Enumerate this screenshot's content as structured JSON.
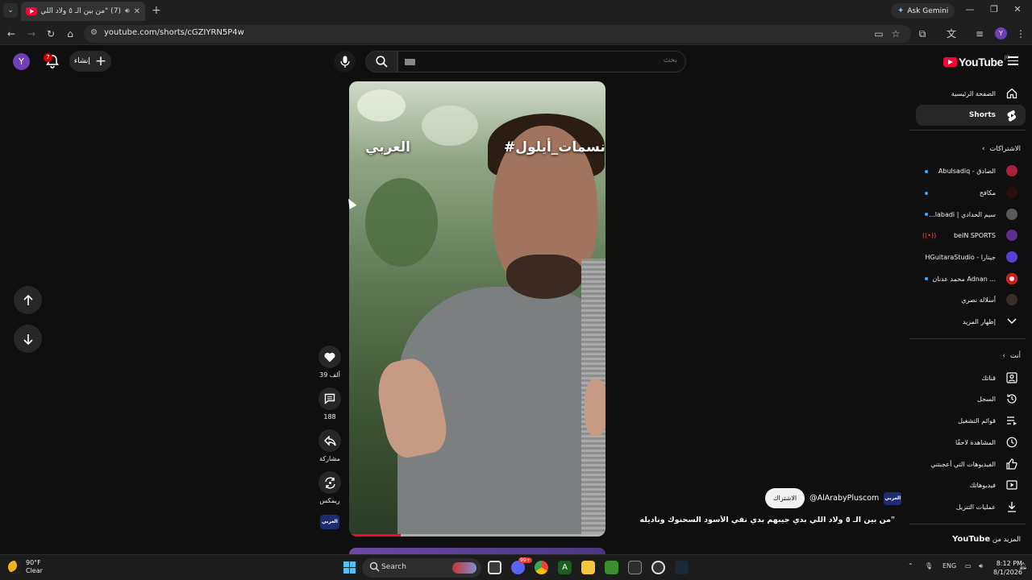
{
  "browser": {
    "tab_title": "(7) \"من بين الـ ٥ ولاد اللي بدي...",
    "ask_gemini": "Ask Gemini",
    "url": "youtube.com/shorts/cGZIYRN5P4w",
    "profile_initial": "Y"
  },
  "header": {
    "avatar_initial": "Y",
    "notifications_count": "7",
    "create_label": "إنشاء",
    "search_placeholder": "بحث",
    "logo_text": "YouTube",
    "logo_country": "JO"
  },
  "video": {
    "overlay_hashtag": "#نسمات_أيلول",
    "overlay_brand": "العربي",
    "progress": 0.2
  },
  "actions": {
    "like_count": "39 ألف",
    "comment_count": "188",
    "share_label": "مشاركة",
    "remix_label": "ريمكس",
    "channel_thumb": "العربي"
  },
  "short_info": {
    "channel_handle": "@AlArabyPluscom",
    "subscribe_label": "الاشتراك",
    "description": "\"من بين الـ ٥ ولاد اللي بدي جيبهم بدي نفي الأسود السحنوك وناديله فوا..."
  },
  "sidebar": {
    "home": "الصفحة الرئيسية",
    "shorts": "Shorts",
    "subscriptions_header": "الاشتراكات",
    "subscriptions": [
      {
        "name": "Abulsadiq - الصادق"
      },
      {
        "name": "مكافح"
      },
      {
        "name": "...labadi | سيم الحدادي"
      },
      {
        "name": "beIN SPORTS"
      },
      {
        "name": "HGuitaraStudio - جيتارا"
      },
      {
        "name": "محمد عدنان Adnan ..."
      },
      {
        "name": "أسلالة نصري"
      }
    ],
    "show_more": "إظهار المزيد",
    "you_header": "أنت",
    "you_items": [
      "قناتك",
      "السجل",
      "قوائم التشغيل",
      "المشاهدة لاحقًا",
      "الفيديوهات التي أعجبتني",
      "فيديوهاتك",
      "عمليات التنزيل"
    ],
    "more_from_prefix": "المزيد من",
    "more_from_brand": "YouTube"
  },
  "taskbar": {
    "temperature": "90°F",
    "condition": "Clear",
    "search_label": "Search",
    "language": "ENG",
    "time": "8:12 PM",
    "date": "8/1/2026",
    "discord_badge": "99+"
  },
  "colors": {
    "accent": "#ff0033",
    "background": "#0f0f0f",
    "link": "#3ea6ff"
  }
}
